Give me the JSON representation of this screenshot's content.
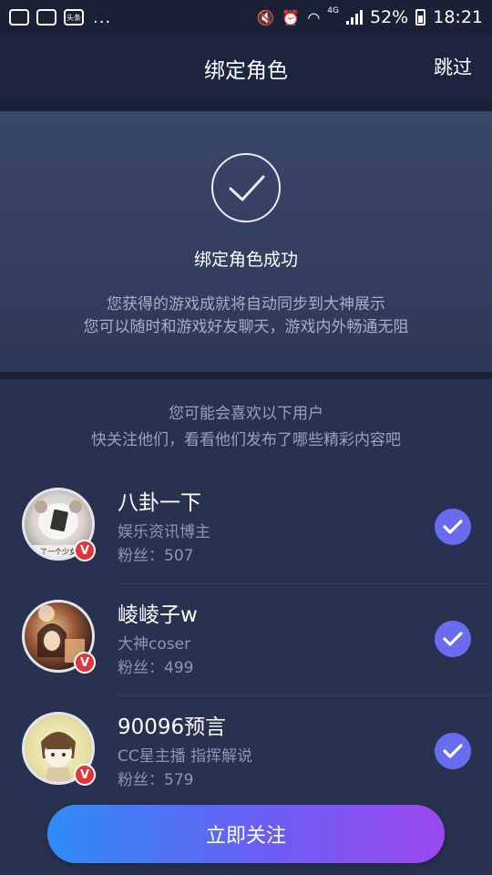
{
  "status_bar": {
    "notif_badge": "头条",
    "more": "...",
    "network": "4G",
    "battery": "52%",
    "time": "18:21"
  },
  "header": {
    "title": "绑定角色",
    "skip_label": "跳过"
  },
  "success": {
    "title": "绑定角色成功",
    "desc_line1": "您获得的游戏成就将自动同步到大神展示",
    "desc_line2": "您可以随时和游戏好友聊天，游戏内外畅通无阻"
  },
  "recommend": {
    "intro_line1": "您可能会喜欢以下用户",
    "intro_line2": "快关注他们，看看他们发布了哪些精彩内容吧",
    "users": [
      {
        "name": "八卦一下",
        "desc": "娱乐资讯博主",
        "fans": "粉丝：507",
        "avatar_text": "了一个少女",
        "verified": "V",
        "selected": true
      },
      {
        "name": "崚崚子w",
        "desc": "大神coser",
        "fans": "粉丝：499",
        "verified": "V",
        "selected": true
      },
      {
        "name": "90096预言",
        "desc": "CC星主播 指挥解说",
        "fans": "粉丝：579",
        "verified": "V",
        "selected": true
      }
    ]
  },
  "action": {
    "follow_all_label": "立即关注"
  },
  "colors": {
    "background": "#27304f",
    "check_accent": "#6a6cf0",
    "verified_badge": "#e2343c",
    "button_gradient_start": "#2f8cf8",
    "button_gradient_end": "#9b47f0"
  }
}
